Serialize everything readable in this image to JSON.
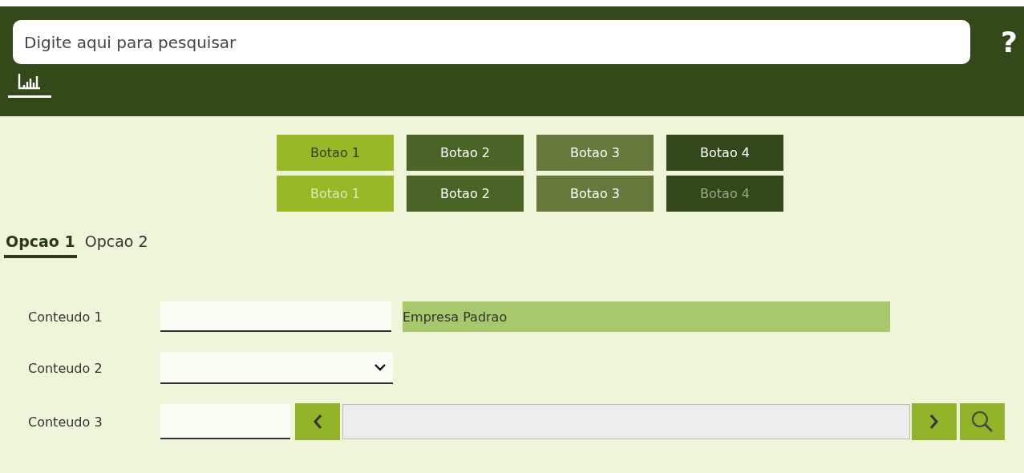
{
  "header": {
    "search": {
      "placeholder": "Digite aqui para pesquisar"
    },
    "help": "?"
  },
  "button_rows": [
    {
      "buttons": [
        {
          "label": "Botao 1",
          "kind": "light",
          "disabled": false
        },
        {
          "label": "Botao 2",
          "kind": "medium",
          "disabled": false
        },
        {
          "label": "Botao 3",
          "kind": "olive",
          "disabled": false
        },
        {
          "label": "Botao 4",
          "kind": "dark",
          "disabled": false
        }
      ]
    },
    {
      "buttons": [
        {
          "label": "Botao 1",
          "kind": "light",
          "disabled": true
        },
        {
          "label": "Botao 2",
          "kind": "medium",
          "disabled": false
        },
        {
          "label": "Botao 3",
          "kind": "olive",
          "disabled": false
        },
        {
          "label": "Botao 4",
          "kind": "dark",
          "disabled": true
        }
      ]
    }
  ],
  "tabs": [
    {
      "label": "Opcao 1",
      "selected": true
    },
    {
      "label": "Opcao 2",
      "selected": false
    }
  ],
  "form": [
    {
      "kind": "text",
      "label": "Conteudo 1",
      "display": "Empresa Padrao"
    },
    {
      "kind": "select",
      "label": "Conteudo 2"
    },
    {
      "kind": "lookup",
      "label": "Conteudo 3"
    }
  ]
}
